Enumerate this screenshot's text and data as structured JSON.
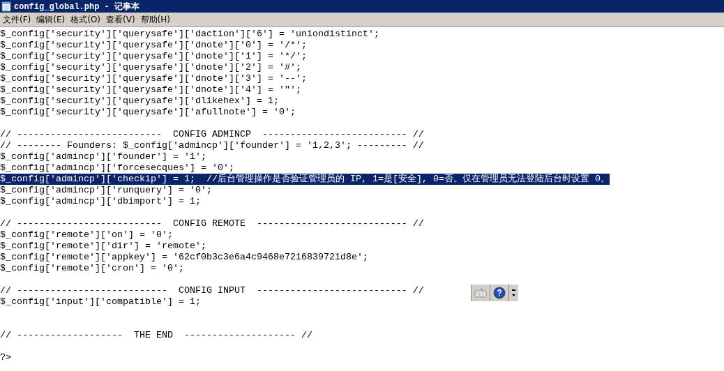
{
  "window": {
    "title": "config_global.php - 记事本"
  },
  "menu": [
    {
      "label": "文件(F)"
    },
    {
      "label": "编辑(E)"
    },
    {
      "label": "格式(O)"
    },
    {
      "label": "查看(V)"
    },
    {
      "label": "帮助(H)"
    }
  ],
  "lines": [
    {
      "kind": "code",
      "text": "$_config['security']['querysafe']['daction']['6'] = 'uniondistinct';",
      "selected": false
    },
    {
      "kind": "code",
      "text": "$_config['security']['querysafe']['dnote']['0'] = '/*';",
      "selected": false
    },
    {
      "kind": "code",
      "text": "$_config['security']['querysafe']['dnote']['1'] = '*/';",
      "selected": false
    },
    {
      "kind": "code",
      "text": "$_config['security']['querysafe']['dnote']['2'] = '#';",
      "selected": false
    },
    {
      "kind": "code",
      "text": "$_config['security']['querysafe']['dnote']['3'] = '--';",
      "selected": false
    },
    {
      "kind": "code",
      "text": "$_config['security']['querysafe']['dnote']['4'] = '\"';",
      "selected": false
    },
    {
      "kind": "code",
      "text": "$_config['security']['querysafe']['dlikehex'] = 1;",
      "selected": false
    },
    {
      "kind": "code",
      "text": "$_config['security']['querysafe']['afullnote'] = '0';",
      "selected": false
    },
    {
      "kind": "blank",
      "selected": false
    },
    {
      "kind": "code",
      "text": "// --------------------------  CONFIG ADMINCP  -------------------------- //",
      "selected": false
    },
    {
      "kind": "code",
      "text": "// -------- Founders: $_config['admincp']['founder'] = '1,2,3'; --------- //",
      "selected": false
    },
    {
      "kind": "code",
      "text": "$_config['admincp']['founder'] = '1';",
      "selected": false
    },
    {
      "kind": "code",
      "text": "$_config['admincp']['forcesecques'] = '0';",
      "selected": false
    },
    {
      "kind": "code",
      "text": "$_config['admincp']['checkip'] = 1;  //后台管理操作是否验证管理员的 IP, 1=是[安全], 0=否。仅在管理员无法登陆后台时设置 0。",
      "selected": true
    },
    {
      "kind": "code",
      "text": "$_config['admincp']['runquery'] = '0';",
      "selected": false
    },
    {
      "kind": "code",
      "text": "$_config['admincp']['dbimport'] = 1;",
      "selected": false
    },
    {
      "kind": "blank",
      "selected": false
    },
    {
      "kind": "code",
      "text": "// --------------------------  CONFIG REMOTE  --------------------------- //",
      "selected": false
    },
    {
      "kind": "code",
      "text": "$_config['remote']['on'] = '0';",
      "selected": false
    },
    {
      "kind": "code",
      "text": "$_config['remote']['dir'] = 'remote';",
      "selected": false
    },
    {
      "kind": "code",
      "text": "$_config['remote']['appkey'] = '62cf0b3c3e6a4c9468e7216839721d8e';",
      "selected": false
    },
    {
      "kind": "code",
      "text": "$_config['remote']['cron'] = '0';",
      "selected": false
    },
    {
      "kind": "blank",
      "selected": false
    },
    {
      "kind": "code",
      "text": "// ---------------------------  CONFIG INPUT  --------------------------- //",
      "selected": false
    },
    {
      "kind": "code",
      "text": "$_config['input']['compatible'] = 1;",
      "selected": false
    },
    {
      "kind": "blank",
      "selected": false
    },
    {
      "kind": "blank",
      "selected": false
    },
    {
      "kind": "code",
      "text": "// -------------------  THE END  -------------------- //",
      "selected": false
    },
    {
      "kind": "blank",
      "selected": false
    },
    {
      "kind": "code",
      "text": "?>",
      "selected": false
    }
  ],
  "ime_toolbar": {
    "buttons": [
      {
        "kind": "keyboard"
      },
      {
        "kind": "help"
      },
      {
        "kind": "menu"
      }
    ]
  }
}
